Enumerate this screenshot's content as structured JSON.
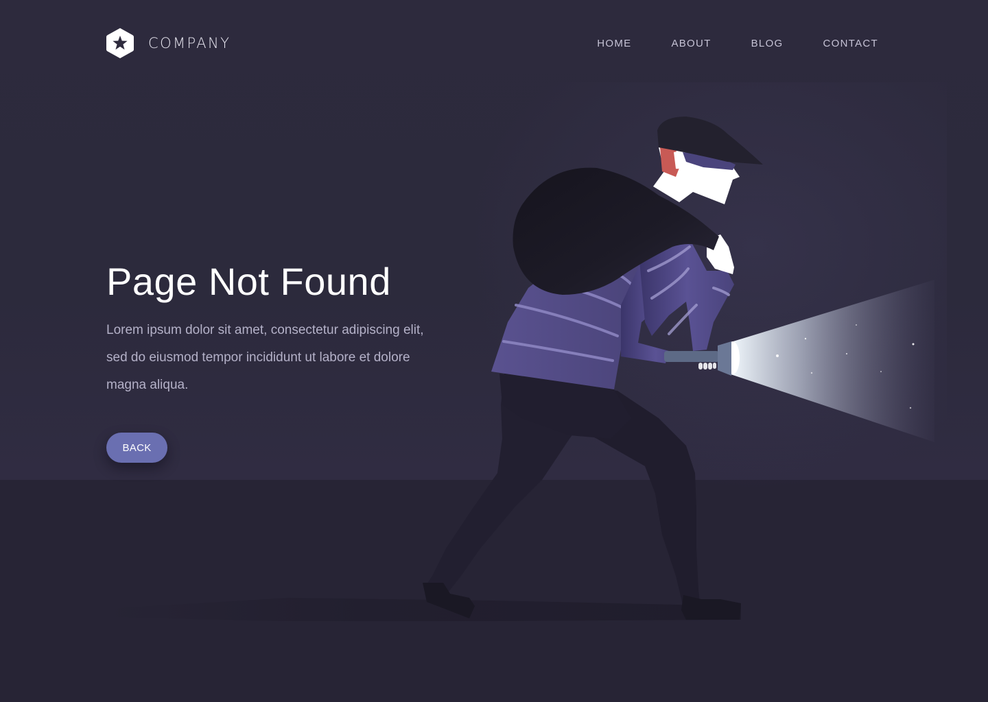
{
  "header": {
    "logo_text": "COMPANY",
    "logo_icon": "star-hexagon-icon",
    "nav": [
      {
        "label": "HOME"
      },
      {
        "label": "ABOUT"
      },
      {
        "label": "BLOG"
      },
      {
        "label": "CONTACT"
      }
    ]
  },
  "hero": {
    "title": "Page Not Found",
    "description": "Lorem ipsum dolor sit amet, consectetur adipiscing elit, sed do eiusmod tempor incididunt ut labore et dolore magna aliqua.",
    "back_label": "BACK"
  },
  "illustration": {
    "subject": "burglar-with-sack-and-flashlight",
    "colors": {
      "background": "#2b2839",
      "floor": "#272435",
      "sweater": "#4f4880",
      "sweater_stripe": "#8f88c4",
      "sack": "#1c1a26",
      "skin": "#ffffff",
      "hair": "#c85a55",
      "mask": "#4a447c",
      "pants": "#201d2d",
      "flashlight": "#5d6a86",
      "beam": "#f4fbff",
      "button": "#6a6fb1"
    }
  }
}
